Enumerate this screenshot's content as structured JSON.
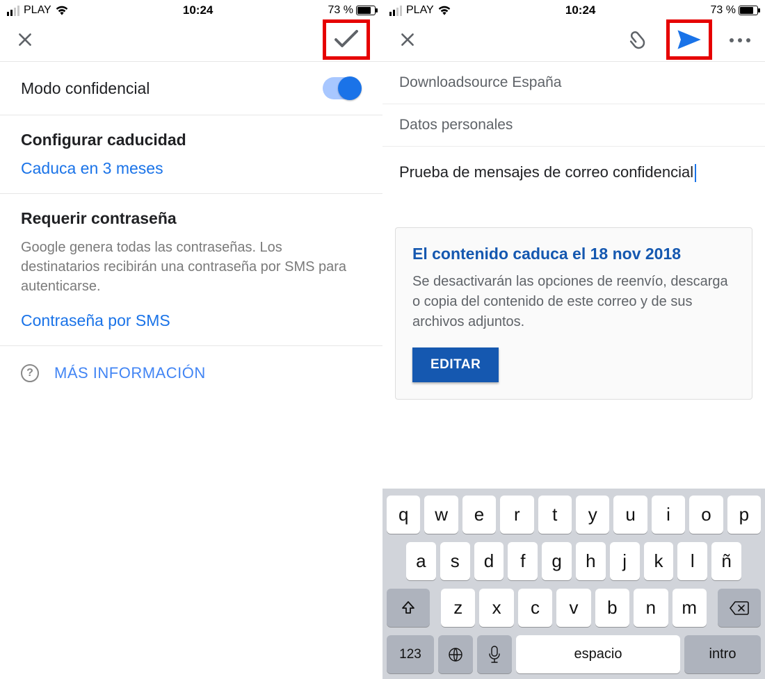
{
  "status_bar": {
    "carrier": "PLAY",
    "time": "10:24",
    "battery_pct": "73 %"
  },
  "left": {
    "mode_label": "Modo confidencial",
    "expire_heading": "Configurar caducidad",
    "expire_value": "Caduca en 3 meses",
    "password_heading": "Requerir contraseña",
    "password_body": "Google genera todas las contraseñas. Los destinatarios recibirán una contraseña por SMS para autenticarse.",
    "password_value": "Contraseña por SMS",
    "more_info": "MÁS INFORMACIÓN"
  },
  "right": {
    "to_field": "Downloadsource España",
    "subject_field": "Datos personales",
    "body_text": "Prueba de mensajes de correo confidencial",
    "card_title": "El contenido caduca el 18 nov 2018",
    "card_body": "Se desactivarán las opciones de reenvío, descarga o copia del contenido de este correo y de sus archivos adjuntos.",
    "edit_button": "EDITAR"
  },
  "keyboard": {
    "row1": [
      "q",
      "w",
      "e",
      "r",
      "t",
      "y",
      "u",
      "i",
      "o",
      "p"
    ],
    "row2": [
      "a",
      "s",
      "d",
      "f",
      "g",
      "h",
      "j",
      "k",
      "l",
      "ñ"
    ],
    "row3": [
      "z",
      "x",
      "c",
      "v",
      "b",
      "n",
      "m"
    ],
    "num_key": "123",
    "space_key": "espacio",
    "return_key": "intro"
  }
}
